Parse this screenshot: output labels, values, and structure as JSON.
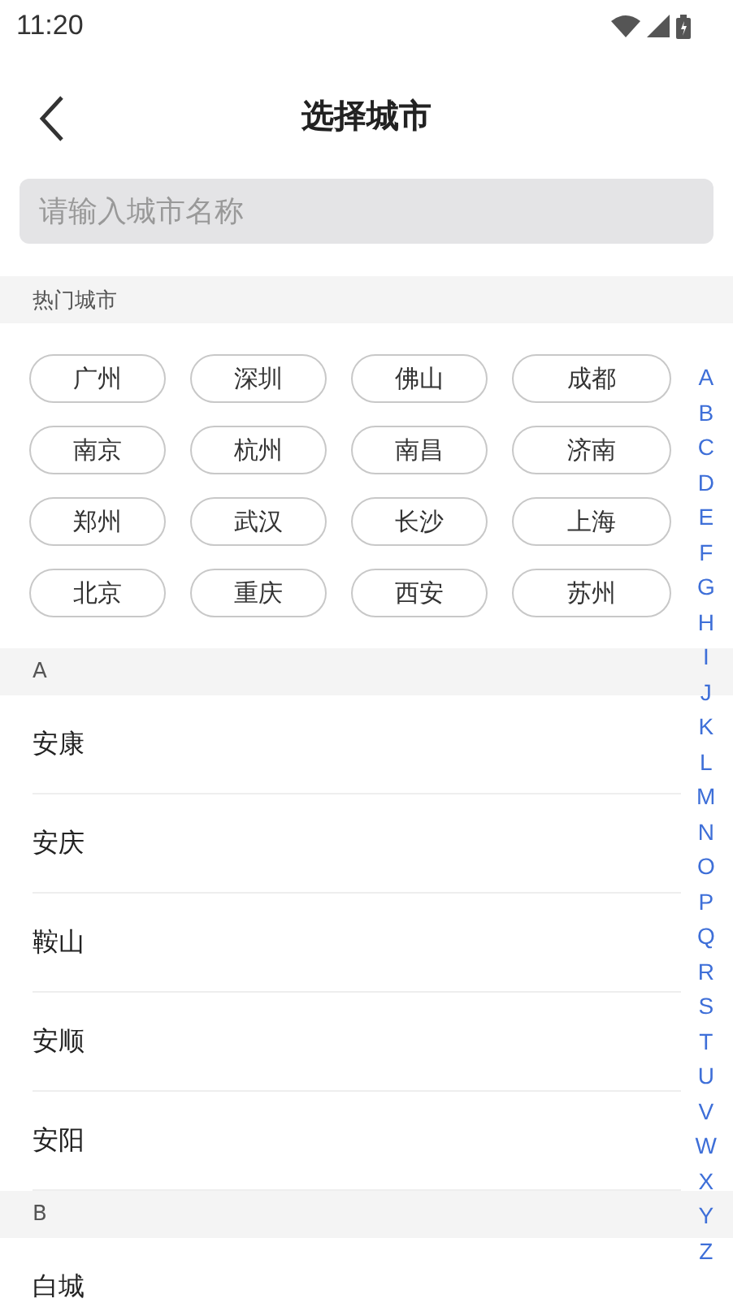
{
  "status_bar": {
    "time": "11:20"
  },
  "header": {
    "title": "选择城市"
  },
  "search": {
    "placeholder": "请输入城市名称"
  },
  "hot_cities": {
    "title": "热门城市",
    "items": [
      "广州",
      "深圳",
      "佛山",
      "成都",
      "南京",
      "杭州",
      "南昌",
      "济南",
      "郑州",
      "武汉",
      "长沙",
      "上海",
      "北京",
      "重庆",
      "西安",
      "苏州"
    ]
  },
  "sections": [
    {
      "letter": "A",
      "cities": [
        "安康",
        "安庆",
        "鞍山",
        "安顺",
        "安阳"
      ]
    },
    {
      "letter": "B",
      "cities": [
        "白城"
      ]
    }
  ],
  "index_bar": [
    "A",
    "B",
    "C",
    "D",
    "E",
    "F",
    "G",
    "H",
    "I",
    "J",
    "K",
    "L",
    "M",
    "N",
    "O",
    "P",
    "Q",
    "R",
    "S",
    "T",
    "U",
    "V",
    "W",
    "X",
    "Y",
    "Z"
  ]
}
